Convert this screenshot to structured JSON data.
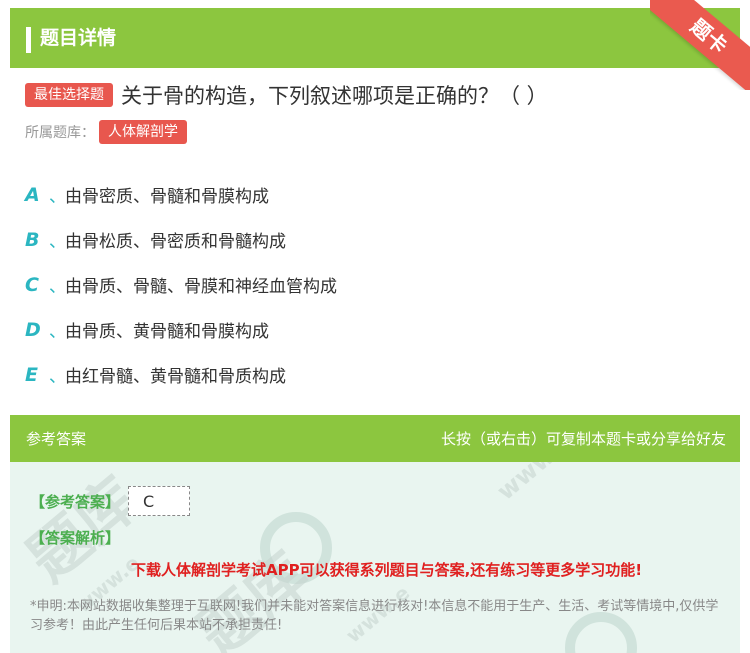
{
  "header": {
    "title": "题目详情",
    "ribbon": "题卡"
  },
  "question": {
    "tag": "最佳选择题",
    "text": "关于骨的构造，下列叙述哪项是正确的？（ ）",
    "source_label": "所属题库：",
    "source": "人体解剖学"
  },
  "options": [
    {
      "letter": "A",
      "sep": "、",
      "text": "由骨密质、骨髓和骨膜构成"
    },
    {
      "letter": "B",
      "sep": "、",
      "text": "由骨松质、骨密质和骨髓构成"
    },
    {
      "letter": "C",
      "sep": "、",
      "text": "由骨质、骨髓、骨膜和神经血管构成"
    },
    {
      "letter": "D",
      "sep": "、",
      "text": "由骨质、黄骨髓和骨膜构成"
    },
    {
      "letter": "E",
      "sep": "、",
      "text": "由红骨髓、黄骨髓和骨质构成"
    }
  ],
  "answer": {
    "section_title": "参考答案",
    "hint": "长按（或右击）可复制本题卡或分享给好友",
    "answer_label": "【参考答案】",
    "answer_value": "C",
    "analysis_label": "【答案解析】",
    "download_text": "下载人体解剖学考试APP可以获得系列题目与答案,还有练习等更多学习功能!",
    "disclaimer": "*申明:本网站数据收集整理于互联网!我们并未能对答案信息进行核对!本信息不能用于生产、生活、考试等情境中,仅供学习参考！由此产生任何后果本站不承担责任!"
  },
  "watermarks": [
    "题库",
    "题库",
    "www.e",
    "www.e",
    "www.e"
  ],
  "colors": {
    "brand_green": "#8cc63f",
    "accent_red": "#e8574e",
    "option_teal": "#2bb6c1"
  }
}
